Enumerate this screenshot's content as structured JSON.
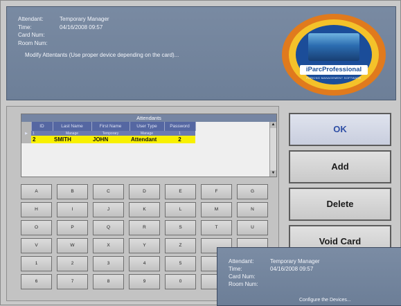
{
  "header": {
    "attendant_label": "Attendant:",
    "attendant_value": "Temporary Manager",
    "time_label": "Time:",
    "time_value": "04/16/2008 09:57",
    "card_label": "Card Num:",
    "room_label": "Room Num:",
    "message": "Modify Attentants (Use proper device depending on the card)...",
    "logo_brand": "iParcProfessional",
    "logo_sub": "PARKING MANAGEMENT SOFTWARE"
  },
  "grid": {
    "title": "Attendants",
    "columns": [
      "ID",
      "Last Name",
      "First Name",
      "User Type",
      "Password"
    ],
    "rows": [
      {
        "id": "1",
        "last": "Manage",
        "first": "Temporary",
        "type": "Manage",
        "pass": "1",
        "marker": "▶"
      },
      {
        "id": "2",
        "last": "SMITH",
        "first": "JOHN",
        "type": "Attendant",
        "pass": "2",
        "marker": ""
      }
    ]
  },
  "keyboard": {
    "rows": [
      [
        "A",
        "B",
        "C",
        "D",
        "E",
        "F",
        "G"
      ],
      [
        "H",
        "I",
        "J",
        "K",
        "L",
        "M",
        "N"
      ],
      [
        "O",
        "P",
        "Q",
        "R",
        "S",
        "T",
        "U"
      ],
      [
        "V",
        "W",
        "X",
        "Y",
        "Z",
        "",
        ""
      ],
      [
        "1",
        "2",
        "3",
        "4",
        "5",
        "",
        ""
      ],
      [
        "6",
        "7",
        "8",
        "9",
        "0",
        "",
        ""
      ]
    ]
  },
  "buttons": {
    "ok": "OK",
    "add": "Add",
    "delete": "Delete",
    "void": "Void Card"
  },
  "overlay": {
    "attendant_label": "Attendant:",
    "attendant_value": "Temporary Manager",
    "time_label": "Time:",
    "time_value": "04/16/2008 09:57",
    "card_label": "Card Num:",
    "room_label": "Room Num:",
    "message": "Configure the Devices..."
  }
}
